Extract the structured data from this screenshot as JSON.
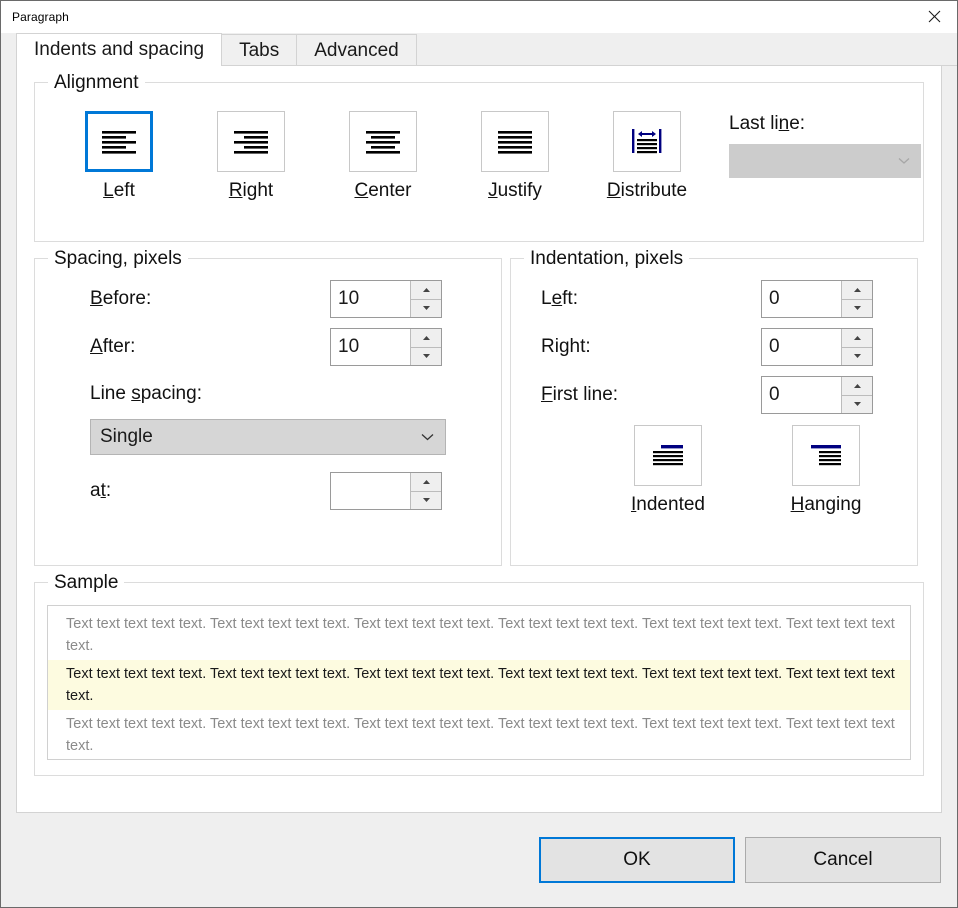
{
  "window": {
    "title": "Paragraph",
    "close_icon": "close-icon"
  },
  "tabs": [
    {
      "label": "Indents and spacing",
      "active": true
    },
    {
      "label": "Tabs",
      "active": false
    },
    {
      "label": "Advanced",
      "active": false
    }
  ],
  "alignment": {
    "group_title": "Alignment",
    "options": [
      {
        "label": "Left",
        "accel": "L",
        "icon": "align-left-icon",
        "selected": true
      },
      {
        "label": "Right",
        "accel": "R",
        "icon": "align-right-icon",
        "selected": false
      },
      {
        "label": "Center",
        "accel": "C",
        "icon": "align-center-icon",
        "selected": false
      },
      {
        "label": "Justify",
        "accel": "J",
        "icon": "align-justify-icon",
        "selected": false
      },
      {
        "label": "Distribute",
        "accel": "D",
        "icon": "align-distribute-icon",
        "selected": false
      }
    ],
    "last_line": {
      "label_pre": "Last li",
      "label_accel": "n",
      "label_post": "e:",
      "value": "",
      "enabled": false
    }
  },
  "spacing": {
    "group_title": "Spacing, pixels",
    "before": {
      "label_pre": "",
      "label_accel": "B",
      "label_post": "efore:",
      "value": "10"
    },
    "after": {
      "label_pre": "",
      "label_accel": "A",
      "label_post": "fter:",
      "value": "10"
    },
    "line_spacing": {
      "label_pre": "Line ",
      "label_accel": "s",
      "label_post": "pacing:",
      "value": "Single"
    },
    "at": {
      "label_pre": "a",
      "label_accel": "t",
      "label_post": ":",
      "value": ""
    }
  },
  "indentation": {
    "group_title": "Indentation, pixels",
    "left": {
      "label_pre": "L",
      "label_accel": "e",
      "label_post": "ft:",
      "value": "0"
    },
    "right": {
      "label_pre": "Right:",
      "label_accel": "",
      "label_post": "",
      "value": "0"
    },
    "first_line": {
      "label_pre": "",
      "label_accel": "F",
      "label_post": "irst line:",
      "value": "0"
    },
    "modes": [
      {
        "label": "Indented",
        "accel": "I",
        "icon": "indent-first-line-icon"
      },
      {
        "label": "Hanging",
        "accel": "H",
        "icon": "indent-hanging-icon"
      }
    ]
  },
  "sample": {
    "group_title": "Sample",
    "paragraphs": [
      {
        "text": "Text text text text text. Text text text text text. Text text text text text. Text text text text text. Text text text text text. Text text text text text.",
        "highlighted": false
      },
      {
        "text": "Text text text text text. Text text text text text. Text text text text text. Text text text text text. Text text text text text. Text text text text text.",
        "highlighted": true
      },
      {
        "text": "Text text text text text. Text text text text text. Text text text text text. Text text text text text. Text text text text text. Text text text text text.",
        "highlighted": false
      }
    ]
  },
  "footer": {
    "ok_label": "OK",
    "cancel_label": "Cancel"
  },
  "colors": {
    "accent": "#0078d7",
    "icon_navy": "#000080",
    "highlight_bg": "#fdfbe0",
    "disabled_bg": "#cccccc"
  }
}
